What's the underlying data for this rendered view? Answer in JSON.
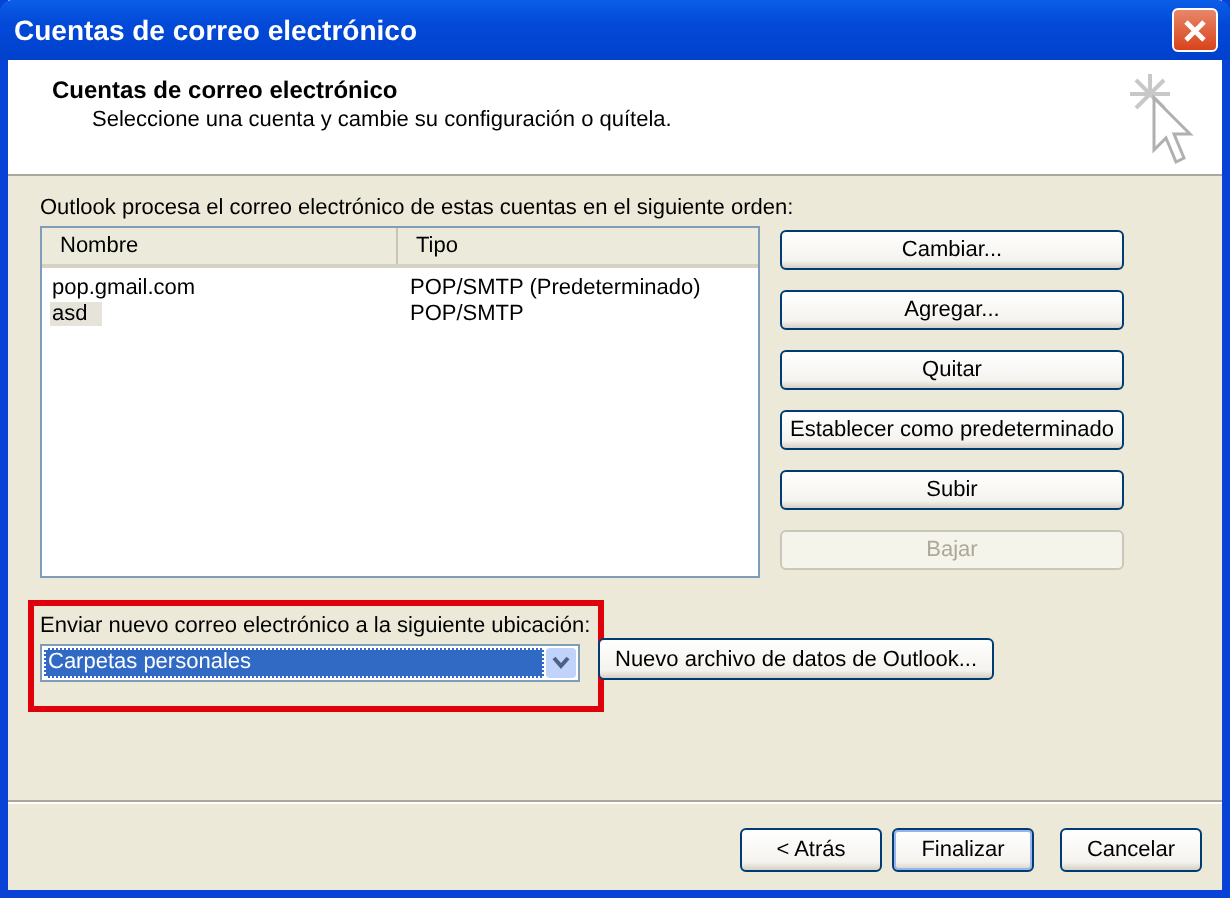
{
  "window": {
    "title": "Cuentas de correo electrónico"
  },
  "header": {
    "title": "Cuentas de correo electrónico",
    "subtitle": "Seleccione una cuenta y cambie su configuración o quítela."
  },
  "intro": "Outlook procesa el correo electrónico de estas cuentas en el siguiente orden:",
  "table": {
    "columns": [
      "Nombre",
      "Tipo"
    ],
    "rows": [
      {
        "name": "pop.gmail.com",
        "type": "POP/SMTP (Predeterminado)",
        "selected": false
      },
      {
        "name": "asd",
        "type": "POP/SMTP",
        "selected": true
      }
    ]
  },
  "side_buttons": [
    {
      "label": "Cambiar...",
      "disabled": false
    },
    {
      "label": "Agregar...",
      "disabled": false
    },
    {
      "label": "Quitar",
      "disabled": false
    },
    {
      "label": "Establecer como predeterminado",
      "disabled": false
    },
    {
      "label": "Subir",
      "disabled": false
    },
    {
      "label": "Bajar",
      "disabled": true
    }
  ],
  "delivery": {
    "label": "Enviar nuevo correo electrónico a la siguiente ubicación:",
    "value": "Carpetas personales",
    "highlighted": true,
    "button": "Nuevo archivo de datos de Outlook..."
  },
  "footer_buttons": [
    {
      "label": "< Atrás",
      "default": false
    },
    {
      "label": "Finalizar",
      "default": true
    },
    {
      "label": "Cancelar",
      "default": false
    }
  ]
}
